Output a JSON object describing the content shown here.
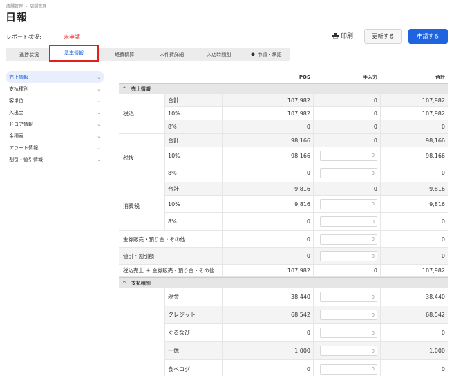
{
  "breadcrumb": [
    "店舗管理",
    "店舗管理"
  ],
  "breadcrumb_sep": "›",
  "title": "日報",
  "report_status": {
    "label": "レポート状況:",
    "value": "未申請"
  },
  "buttons": {
    "print": "印刷",
    "update": "更新する",
    "apply": "申請する"
  },
  "tabs": [
    "進捗状況",
    "基本情報",
    "経費精算",
    "人件費詳細",
    "入店時間別",
    "申請・承認"
  ],
  "active_tab": "基本情報",
  "sidebar": [
    {
      "label": "売上情報",
      "active": true
    },
    {
      "label": "支払種別"
    },
    {
      "label": "客単位"
    },
    {
      "label": "入出金"
    },
    {
      "label": "ドロア情報"
    },
    {
      "label": "金種表"
    },
    {
      "label": "アラート情報"
    },
    {
      "label": "割引・値引情報"
    }
  ],
  "table": {
    "headers": {
      "pos": "POS",
      "manual": "手入力",
      "total": "合計"
    },
    "sections": {
      "sales": "売上情報",
      "payment": "支払種別"
    },
    "zei_komi": {
      "label": "税込",
      "rows": [
        {
          "sub": "合計",
          "pos": "107,982",
          "man": "0",
          "tot": "107,982"
        },
        {
          "sub": "10%",
          "pos": "107,982",
          "man": "0",
          "tot": "107,982"
        },
        {
          "sub": "8%",
          "pos": "0",
          "man": "0",
          "tot": "0"
        }
      ]
    },
    "zei_nuki": {
      "label": "税抜",
      "rows": [
        {
          "sub": "合計",
          "pos": "98,166",
          "man": "0",
          "tot": "98,166"
        },
        {
          "sub": "10%",
          "pos": "98,166",
          "man": "0",
          "tot": "98,166"
        },
        {
          "sub": "8%",
          "pos": "0",
          "man": "0",
          "tot": "0"
        }
      ]
    },
    "shohi": {
      "label": "消費税",
      "rows": [
        {
          "sub": "合計",
          "pos": "9,816",
          "man": "0",
          "tot": "9,816"
        },
        {
          "sub": "10%",
          "pos": "9,816",
          "man": "0",
          "tot": "9,816"
        },
        {
          "sub": "8%",
          "pos": "0",
          "man": "0",
          "tot": "0"
        }
      ]
    },
    "full_rows": [
      {
        "label": "金券販売・預り金・その他",
        "pos": "0",
        "man": "0",
        "tot": "0"
      },
      {
        "label": "値引・割引額",
        "pos": "0",
        "man": "0",
        "tot": "0"
      },
      {
        "label": "税込売上 ＋ 金券販売・預り金・その他",
        "pos": "107,982",
        "man": "0",
        "tot": "107,982"
      }
    ],
    "payment_rows": [
      {
        "sub": "現金",
        "pos": "38,440",
        "man": "0",
        "tot": "38,440"
      },
      {
        "sub": "クレジット",
        "pos": "68,542",
        "man": "0",
        "tot": "68,542"
      },
      {
        "sub": "ぐるなび",
        "pos": "0",
        "man": "0",
        "tot": "0"
      },
      {
        "sub": "一休",
        "pos": "1,000",
        "man": "0",
        "tot": "1,000"
      },
      {
        "sub": "食べログ",
        "pos": "0",
        "man": "0",
        "tot": "0"
      }
    ]
  },
  "colors": {
    "accent": "#1e64de",
    "alert": "#e53935",
    "highlight": "#e0201b"
  }
}
